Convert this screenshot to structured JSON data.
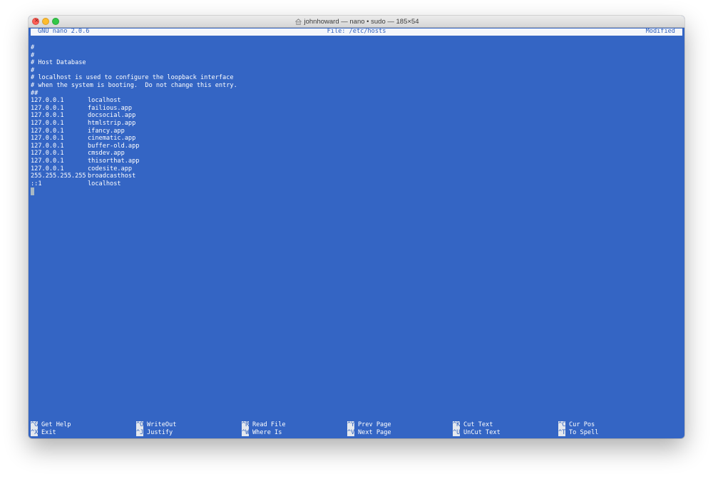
{
  "window": {
    "title": "johnhoward — nano • sudo — 185×54"
  },
  "nano": {
    "version": "GNU nano 2.0.6",
    "file": "File: /etc/hosts",
    "status": "Modified"
  },
  "file_lines": [
    {
      "text": "#"
    },
    {
      "text": "#"
    },
    {
      "text": "# Host Database"
    },
    {
      "text": "#"
    },
    {
      "text": "# localhost is used to configure the loopback interface"
    },
    {
      "text": "# when the system is booting.  Do not change this entry."
    },
    {
      "text": "##"
    }
  ],
  "hosts": [
    {
      "ip": "127.0.0.1",
      "host": "localhost"
    },
    {
      "ip": "127.0.0.1",
      "host": "failious.app"
    },
    {
      "ip": "127.0.0.1",
      "host": "docsocial.app"
    },
    {
      "ip": "127.0.0.1",
      "host": "htmlstrip.app"
    },
    {
      "ip": "127.0.0.1",
      "host": "ifancy.app"
    },
    {
      "ip": "127.0.0.1",
      "host": "cinematic.app"
    },
    {
      "ip": "127.0.0.1",
      "host": "buffer-old.app"
    },
    {
      "ip": "127.0.0.1",
      "host": "cmsdev.app"
    },
    {
      "ip": "127.0.0.1",
      "host": "thisorthat.app"
    },
    {
      "ip": "127.0.0.1",
      "host": "codesite.app"
    },
    {
      "ip": "255.255.255.255",
      "host": "broadcasthost"
    },
    {
      "ip": "::1",
      "host": "localhost"
    }
  ],
  "shortcuts": [
    {
      "key": "^G",
      "label": "Get Help"
    },
    {
      "key": "^X",
      "label": "Exit"
    },
    {
      "key": "^O",
      "label": "WriteOut"
    },
    {
      "key": "^J",
      "label": "Justify"
    },
    {
      "key": "^R",
      "label": "Read File"
    },
    {
      "key": "^W",
      "label": "Where Is"
    },
    {
      "key": "^Y",
      "label": "Prev Page"
    },
    {
      "key": "^V",
      "label": "Next Page"
    },
    {
      "key": "^K",
      "label": "Cut Text"
    },
    {
      "key": "^U",
      "label": "UnCut Text"
    },
    {
      "key": "^C",
      "label": "Cur Pos"
    },
    {
      "key": "^T",
      "label": "To Spell"
    }
  ],
  "colors": {
    "editor_background": "#3465c4",
    "editor_text": "#ffffff",
    "statusbar_background": "#f4f6fb",
    "statusbar_text": "#2d5fbd",
    "cursor": "#a7b7c3"
  },
  "icons": {
    "title_icon": "user-home-icon"
  }
}
